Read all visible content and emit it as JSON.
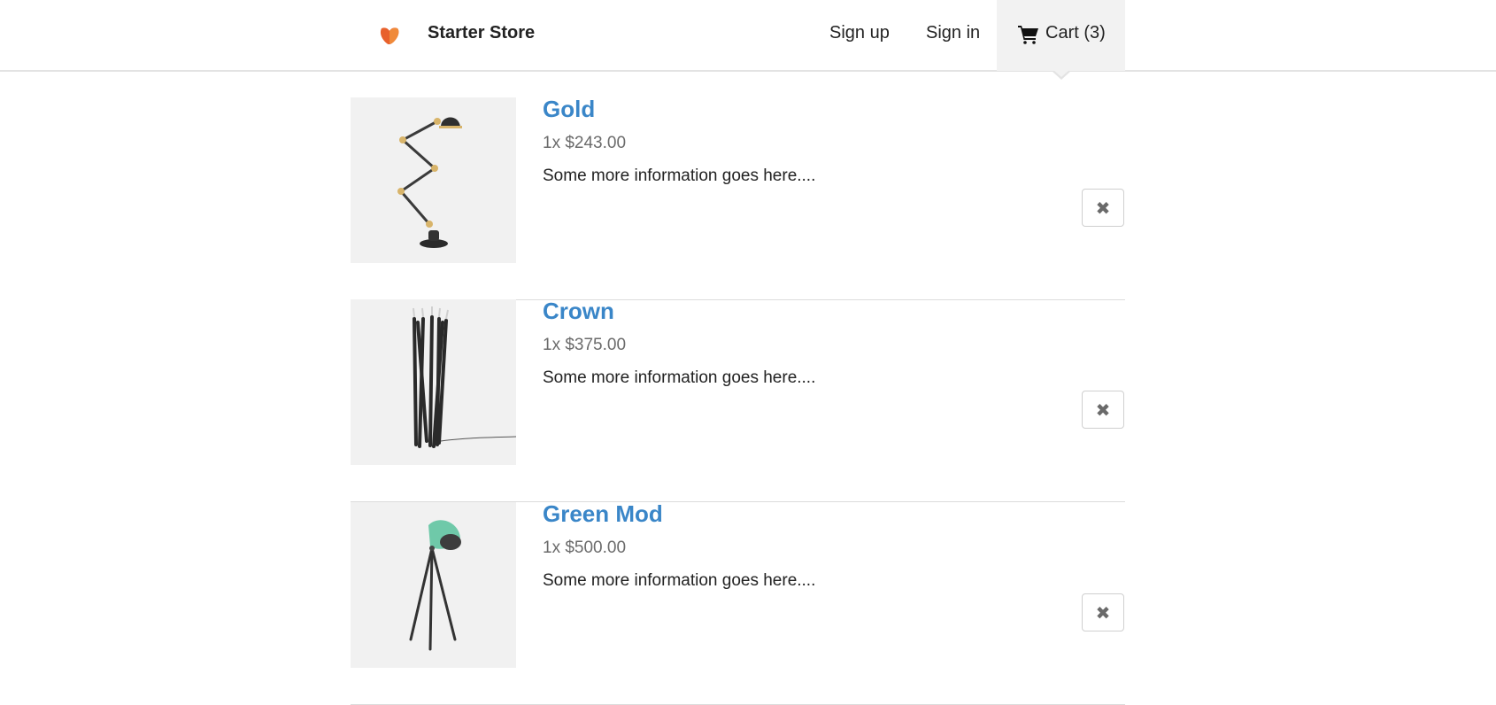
{
  "header": {
    "brand": "Starter Store",
    "nav": {
      "signup": "Sign up",
      "signin": "Sign in",
      "cart": "Cart (3)"
    }
  },
  "colors": {
    "accent": "#3a86c8",
    "logo": "#e8612c",
    "active_nav_bg": "#f2f2f2"
  },
  "cart": {
    "items": [
      {
        "name": "Gold",
        "price": "1x $243.00",
        "description": "Some more information goes here....",
        "remove_icon": "✖"
      },
      {
        "name": "Crown",
        "price": "1x $375.00",
        "description": "Some more information goes here....",
        "remove_icon": "✖"
      },
      {
        "name": "Green Mod",
        "price": "1x $500.00",
        "description": "Some more information goes here....",
        "remove_icon": "✖"
      }
    ]
  }
}
